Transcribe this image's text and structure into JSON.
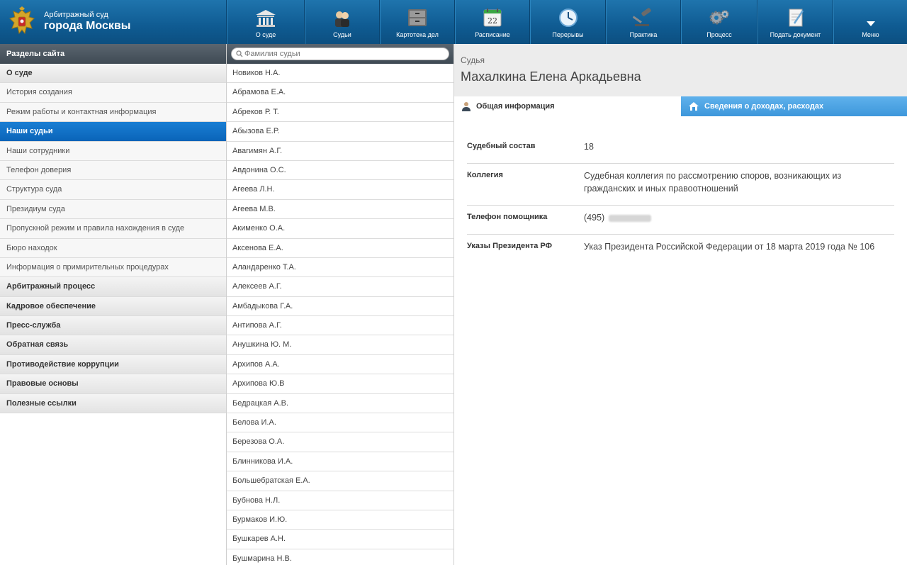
{
  "header": {
    "court_line1": "Арбитражный суд",
    "court_line2": "города Москвы",
    "nav": [
      {
        "label": "О суде",
        "icon": "building-icon"
      },
      {
        "label": "Судьи",
        "icon": "judges-icon"
      },
      {
        "label": "Картотека дел",
        "icon": "file-cabinet-icon"
      },
      {
        "label": "Расписание",
        "icon": "calendar-icon",
        "day": "22"
      },
      {
        "label": "Перерывы",
        "icon": "clock-icon"
      },
      {
        "label": "Практика",
        "icon": "gavel-icon"
      },
      {
        "label": "Процесс",
        "icon": "gears-icon"
      },
      {
        "label": "Подать документ",
        "icon": "document-pen-icon"
      },
      {
        "label": "Меню",
        "icon": "chevron-down-icon"
      }
    ]
  },
  "sidebar": {
    "title": "Разделы сайта",
    "items": [
      {
        "label": "О суде",
        "kind": "section"
      },
      {
        "label": "История создания",
        "kind": "sub"
      },
      {
        "label": "Режим работы и контактная информация",
        "kind": "sub"
      },
      {
        "label": "Наши судьи",
        "kind": "active"
      },
      {
        "label": "Наши сотрудники",
        "kind": "sub"
      },
      {
        "label": "Телефон доверия",
        "kind": "sub"
      },
      {
        "label": "Структура суда",
        "kind": "sub"
      },
      {
        "label": "Президиум суда",
        "kind": "sub"
      },
      {
        "label": "Пропускной режим и правила нахождения в суде",
        "kind": "sub"
      },
      {
        "label": "Бюро находок",
        "kind": "sub"
      },
      {
        "label": "Информация о примирительных процедурах",
        "kind": "sub"
      },
      {
        "label": "Арбитражный процесс",
        "kind": "section"
      },
      {
        "label": "Кадровое обеспечение",
        "kind": "section"
      },
      {
        "label": "Пресс-служба",
        "kind": "section"
      },
      {
        "label": "Обратная связь",
        "kind": "section"
      },
      {
        "label": "Противодействие коррупции",
        "kind": "section"
      },
      {
        "label": "Правовые основы",
        "kind": "section"
      },
      {
        "label": "Полезные ссылки",
        "kind": "section"
      }
    ]
  },
  "judges": {
    "search_placeholder": "Фамилия судьи",
    "list": [
      "Новиков Н.А.",
      "Абрамова Е.А.",
      "Абреков Р. Т.",
      "Абызова Е.Р.",
      "Авагимян А.Г.",
      "Авдонина О.С.",
      "Агеева Л.Н.",
      "Агеева М.В.",
      "Акименко О.А.",
      "Аксенова Е.А.",
      "Аландаренко Т.А.",
      "Алексеев А.Г.",
      "Амбадыкова Г.А.",
      "Антипова А.Г.",
      "Анушкина Ю. М.",
      "Архипов А.А.",
      "Архипова Ю.В",
      "Бедрацкая А.В.",
      "Белова И.А.",
      "Березова О.А.",
      "Блинникова И.А.",
      "Большебратская Е.А.",
      "Бубнова Н.Л.",
      "Бурмаков И.Ю.",
      "Бушкарев А.Н.",
      "Бушмарина Н.В."
    ]
  },
  "detail": {
    "kind": "Судья",
    "name": "Махалкина Елена Аркадьевна",
    "tab_general": "Общая информация",
    "tab_income": "Сведения о доходах, расходах",
    "fields": [
      {
        "label": "Судебный состав",
        "value": "18"
      },
      {
        "label": "Коллегия",
        "value": "Судебная коллегия по рассмотрению споров, возникающих из гражданских и иных правоотношений"
      },
      {
        "label": "Телефон помощника",
        "value": "(495)"
      },
      {
        "label": "Указы Президента РФ",
        "value": "Указ Президента Российской Федерации от 18 марта 2019 года № 106"
      }
    ]
  }
}
